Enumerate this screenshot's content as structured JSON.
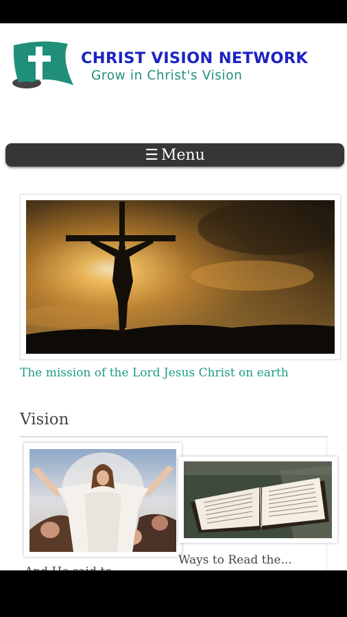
{
  "header": {
    "brand_title": "CHRIST VISION NETWORK",
    "tagline": "Grow in Christ's Vision"
  },
  "menu": {
    "icon": "☰",
    "label": "Menu"
  },
  "hero": {
    "caption": "The mission of the Lord Jesus Christ on earth"
  },
  "vision": {
    "heading": "Vision",
    "cards": [
      {
        "title": "And He said to..."
      },
      {
        "title": "Ways to Read the..."
      }
    ]
  },
  "colors": {
    "brand_blue": "#1c23c4",
    "brand_teal": "#1f8f7a",
    "menu_bg": "#363636",
    "caption_teal": "#1a9a86"
  }
}
